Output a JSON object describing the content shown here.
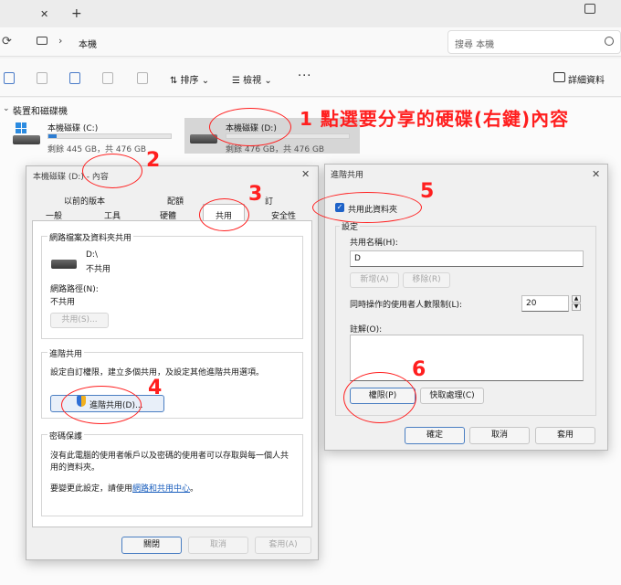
{
  "explorer": {
    "tab_close": "✕",
    "tab_new": "+",
    "refresh": "⟳",
    "crumb_sep": "›",
    "crumb": "本機",
    "search_placeholder": "搜尋 本機",
    "toolbar": {
      "sort": "⇅ 排序 ⌄",
      "view": "☰ 檢視 ⌄",
      "more": "···",
      "details": "詳細資料"
    },
    "group_title": "裝置和磁碟機",
    "drives": [
      {
        "name": "本機磁碟 (C:)",
        "free": "剩餘 445 GB，共 476 GB",
        "used_fraction": 0.07
      },
      {
        "name": "本機磁碟 (D:)",
        "free": "剩餘 476 GB，共 476 GB",
        "used_fraction": 0.0
      }
    ]
  },
  "annotations": {
    "step1": "1 點選要分享的硬碟(右鍵)內容",
    "n2": "2",
    "n3": "3",
    "n4": "4",
    "n5": "5",
    "n6": "6",
    "color": "#ff1f1f"
  },
  "properties": {
    "title": "本機磁碟 (D:) - 內容",
    "close": "✕",
    "tabs_row1": [
      "以前的版本",
      "配額",
      "訂"
    ],
    "tabs_row2": [
      "一般",
      "工具",
      "硬體",
      "共用",
      "安全性"
    ],
    "net_share_group": "網路檔案及資料夾共用",
    "drive_label": "D:\\",
    "not_shared": "不共用",
    "net_path_label": "網路路徑(N):",
    "net_path_value": "不共用",
    "share_btn": "共用(S)...",
    "adv_group": "進階共用",
    "adv_desc": "設定自訂權限，建立多個共用，及設定其他進階共用選項。",
    "adv_btn": "進階共用(D)...",
    "pw_group": "密碼保護",
    "pw_desc1": "沒有此電腦的使用者帳戶以及密碼的使用者可以存取與每一個人共",
    "pw_desc2": "用的資料夾。",
    "pw_change_prefix": "要變更此設定，請使用",
    "pw_change_link": "網路和共用中心",
    "pw_change_suffix": "。",
    "ok": "關閉",
    "cancel": "取消",
    "apply": "套用(A)"
  },
  "advanced": {
    "title": "進階共用",
    "close": "✕",
    "share_checkbox": "共用此資料夾",
    "checked": true,
    "settings_group": "設定",
    "share_name_label": "共用名稱(H):",
    "share_name_value": "D",
    "add_btn": "新增(A)",
    "remove_btn": "移除(R)",
    "limit_label": "同時操作的使用者人數限制(L):",
    "limit_value": "20",
    "comment_label": "註解(O):",
    "perm_btn": "權限(P)",
    "cache_btn": "快取處理(C)",
    "ok": "確定",
    "cancel": "取消",
    "apply": "套用"
  }
}
